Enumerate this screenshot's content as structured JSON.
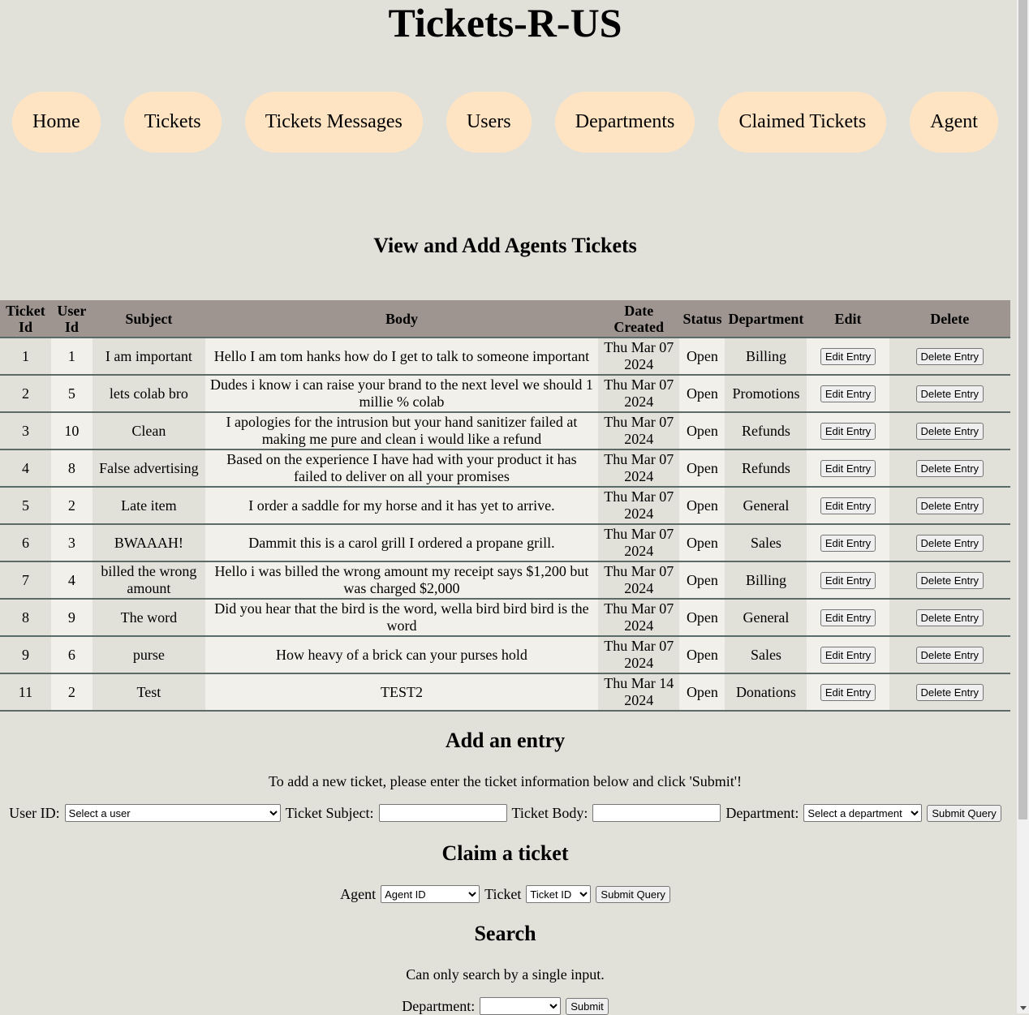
{
  "header": {
    "title": "Tickets-R-US"
  },
  "nav": [
    {
      "label": "Home"
    },
    {
      "label": "Tickets"
    },
    {
      "label": "Tickets Messages"
    },
    {
      "label": "Users"
    },
    {
      "label": "Departments"
    },
    {
      "label": "Claimed Tickets"
    },
    {
      "label": "Agent"
    }
  ],
  "view_section": {
    "title": "View and Add Agents Tickets"
  },
  "table": {
    "headers": {
      "ticket_id": "Ticket Id",
      "user_id": "User Id",
      "subject": "Subject",
      "body": "Body",
      "date_created": "Date Created",
      "status": "Status",
      "department": "Department",
      "edit": "Edit",
      "delete": "Delete"
    },
    "edit_label": "Edit Entry",
    "delete_label": "Delete Entry",
    "rows": [
      {
        "ticket_id": "1",
        "user_id": "1",
        "subject": "I am important",
        "body": "Hello I am tom hanks how do I get to talk to someone important",
        "date": "Thu Mar 07 2024",
        "status": "Open",
        "department": "Billing"
      },
      {
        "ticket_id": "2",
        "user_id": "5",
        "subject": "lets colab bro",
        "body": "Dudes i know i can raise your brand to the next level we should 1 millie % colab",
        "date": "Thu Mar 07 2024",
        "status": "Open",
        "department": "Promotions"
      },
      {
        "ticket_id": "3",
        "user_id": "10",
        "subject": "Clean",
        "body": "I apologies for the intrusion but your hand sanitizer failed at making me pure and clean i would like a refund",
        "date": "Thu Mar 07 2024",
        "status": "Open",
        "department": "Refunds"
      },
      {
        "ticket_id": "4",
        "user_id": "8",
        "subject": "False advertising",
        "body": "Based on the experience I have had with your product it has failed to deliver on all your promises",
        "date": "Thu Mar 07 2024",
        "status": "Open",
        "department": "Refunds"
      },
      {
        "ticket_id": "5",
        "user_id": "2",
        "subject": "Late item",
        "body": "I order a saddle for my horse and it has yet to arrive.",
        "date": "Thu Mar 07 2024",
        "status": "Open",
        "department": "General"
      },
      {
        "ticket_id": "6",
        "user_id": "3",
        "subject": "BWAAAH!",
        "body": "Dammit this is a carol grill I ordered a propane grill.",
        "date": "Thu Mar 07 2024",
        "status": "Open",
        "department": "Sales"
      },
      {
        "ticket_id": "7",
        "user_id": "4",
        "subject": "billed the wrong amount",
        "body": "Hello i was billed the wrong amount my receipt says $1,200 but was charged $2,000",
        "date": "Thu Mar 07 2024",
        "status": "Open",
        "department": "Billing"
      },
      {
        "ticket_id": "8",
        "user_id": "9",
        "subject": "The word",
        "body": "Did you hear that the bird is the word, wella bird bird bird is the word",
        "date": "Thu Mar 07 2024",
        "status": "Open",
        "department": "General"
      },
      {
        "ticket_id": "9",
        "user_id": "6",
        "subject": "purse",
        "body": "How heavy of a brick can your purses hold",
        "date": "Thu Mar 07 2024",
        "status": "Open",
        "department": "Sales"
      },
      {
        "ticket_id": "11",
        "user_id": "2",
        "subject": "Test",
        "body": "TEST2",
        "date": "Thu Mar 14 2024",
        "status": "Open",
        "department": "Donations"
      }
    ]
  },
  "add_entry": {
    "title": "Add an entry",
    "hint": "To add a new ticket, please enter the ticket information below and click 'Submit'!",
    "user_label": "User ID:",
    "user_select": "Select a user",
    "subject_label": "Ticket Subject:",
    "subject_value": "",
    "body_label": "Ticket Body:",
    "body_value": "",
    "department_label": "Department:",
    "department_select": "Select a department",
    "submit_label": "Submit Query"
  },
  "claim": {
    "title": "Claim a ticket",
    "agent_label": "Agent",
    "agent_select": "Agent ID",
    "ticket_label": "Ticket",
    "ticket_select": "Ticket ID",
    "submit_label": "Submit Query"
  },
  "search": {
    "title": "Search",
    "hint": "Can only search by a single input.",
    "department_label": "Department:",
    "department_select": "",
    "submit_label": "Submit"
  }
}
